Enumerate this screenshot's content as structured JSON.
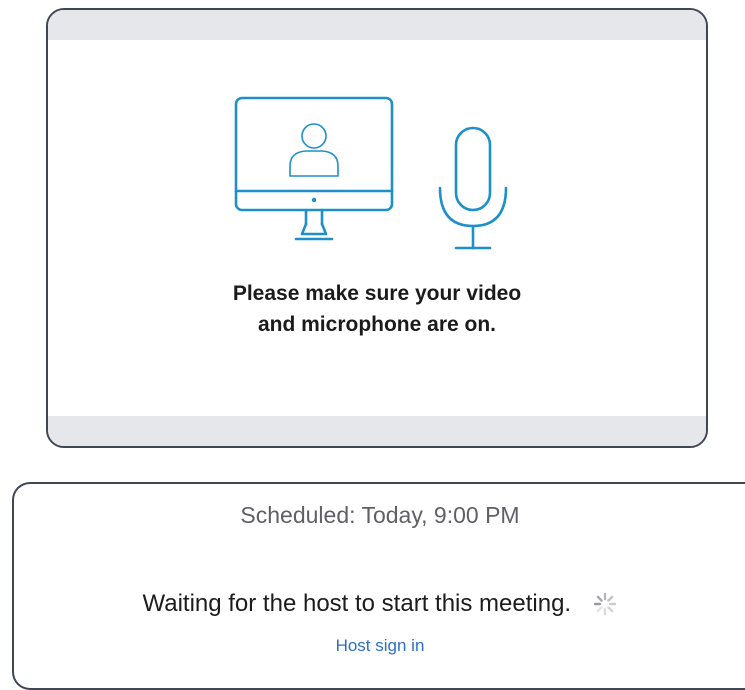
{
  "prompt": {
    "line1": "Please make sure your video",
    "line2": "and microphone are on."
  },
  "illustration": {
    "monitor_icon": "monitor-user-icon",
    "microphone_icon": "microphone-icon",
    "stroke_color": "#1f8fc9"
  },
  "meeting": {
    "scheduled": "Scheduled: Today, 9:00 PM",
    "waiting": "Waiting for the host to start this meeting.",
    "host_sign_in": "Host sign in",
    "spinner_icon": "loading-spinner-icon",
    "link_color": "#2d6fc6"
  }
}
